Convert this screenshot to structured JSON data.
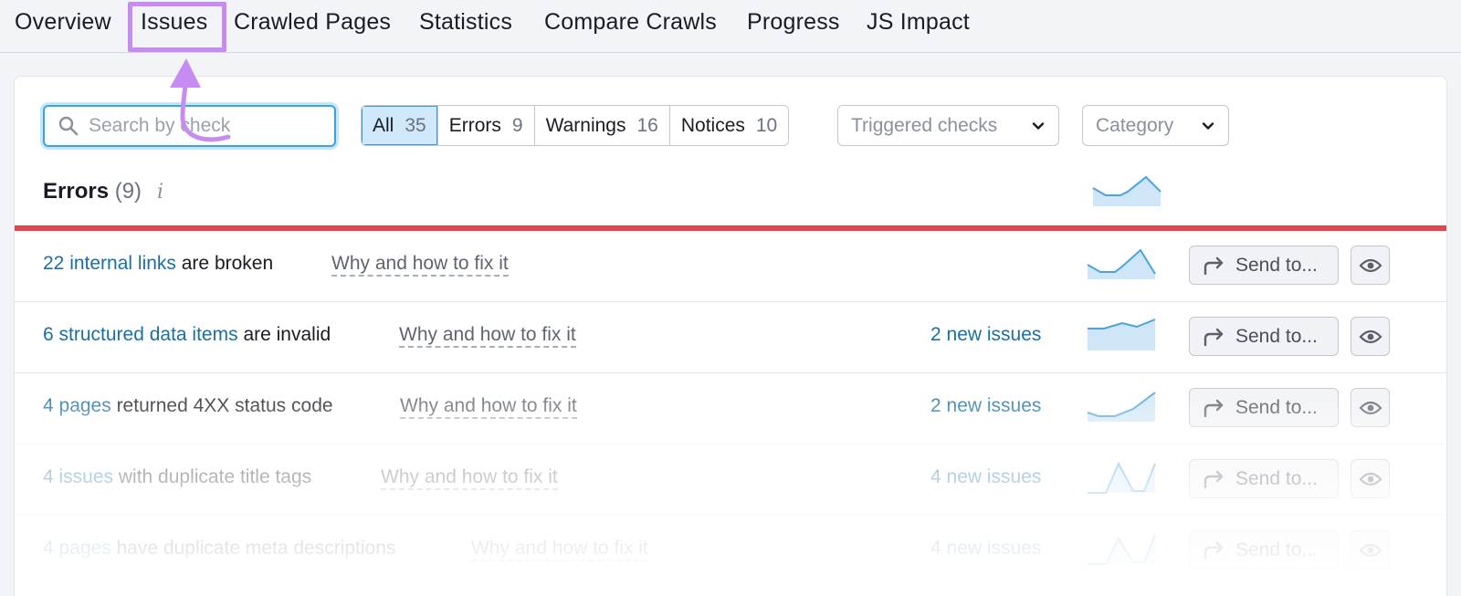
{
  "nav": {
    "tabs": [
      {
        "label": "Overview"
      },
      {
        "label": "Issues"
      },
      {
        "label": "Crawled Pages"
      },
      {
        "label": "Statistics"
      },
      {
        "label": "Compare Crawls"
      },
      {
        "label": "Progress"
      },
      {
        "label": "JS Impact"
      }
    ],
    "active_tab": "Issues"
  },
  "toolbar": {
    "search_placeholder": "Search by check",
    "filters": [
      {
        "label": "All",
        "count": "35",
        "active": true
      },
      {
        "label": "Errors",
        "count": "9"
      },
      {
        "label": "Warnings",
        "count": "16"
      },
      {
        "label": "Notices",
        "count": "10"
      }
    ],
    "triggered_checks_label": "Triggered checks",
    "category_label": "Category"
  },
  "section": {
    "title": "Errors",
    "count": "(9)",
    "info_glyph": "i",
    "accent_color": "#e0464e"
  },
  "issues": [
    {
      "link": "22 internal links",
      "text": " are broken",
      "why": "Why and how to fix it",
      "new_issues": "",
      "send": "Send to..."
    },
    {
      "link": "6 structured data items",
      "text": " are invalid",
      "why": "Why and how to fix it",
      "new_issues": "2 new issues",
      "send": "Send to..."
    },
    {
      "link": "4 pages",
      "text": " returned 4XX status code",
      "why": "Why and how to fix it",
      "new_issues": "2 new issues",
      "send": "Send to..."
    },
    {
      "link": "4 issues",
      "text": " with duplicate title tags",
      "why": "Why and how to fix it",
      "new_issues": "4 new issues",
      "send": "Send to..."
    },
    {
      "link": "4 pages",
      "text": " have duplicate meta descriptions",
      "why": "Why and how to fix it",
      "new_issues": "4 new issues",
      "send": "Send to..."
    }
  ],
  "icons": {
    "search": "search-icon",
    "chevron": "chevron-down-icon",
    "share": "share-arrow-icon",
    "eye": "eye-icon",
    "info": "info-icon",
    "annotation_arrow": "annotation-arrow-icon"
  },
  "colors": {
    "highlight": "#c68cf2",
    "link": "#1a6fa3",
    "active_filter_bg": "#cfe9fb",
    "spark_fill": "#cfe6f8",
    "spark_stroke": "#4aa3df"
  }
}
